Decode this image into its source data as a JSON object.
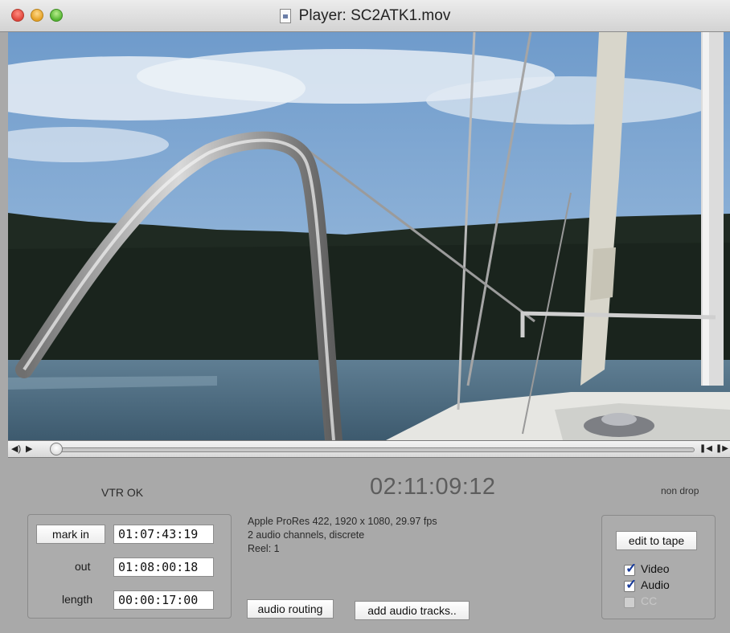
{
  "window": {
    "title": "Player: SC2ATK1.mov"
  },
  "transport": {
    "volume_icon": "speaker-icon",
    "play_icon": "play-icon",
    "step_back_icon": "step-back-icon",
    "step_forward_icon": "step-forward-icon",
    "playhead_position": 0.0
  },
  "status": {
    "vtr": "VTR OK",
    "timecode": "02:11:09:12",
    "drop_mode": "non drop"
  },
  "marks": {
    "mark_in_label": "mark in",
    "mark_in_value": "01:07:43:19",
    "out_label": "out",
    "out_value": "01:08:00:18",
    "length_label": "length",
    "length_value": "00:00:17:00"
  },
  "media_info": {
    "line1": "Apple ProRes 422, 1920 x 1080, 29.97 fps",
    "line2": "2 audio channels, discrete",
    "line3": "Reel: 1"
  },
  "buttons": {
    "audio_routing": "audio routing",
    "add_audio_tracks": "add audio tracks..",
    "edit_to_tape": "edit to tape"
  },
  "options": {
    "video": {
      "label": "Video",
      "checked": true,
      "enabled": true
    },
    "audio": {
      "label": "Audio",
      "checked": true,
      "enabled": true
    },
    "cc": {
      "label": "CC",
      "checked": false,
      "enabled": false
    }
  },
  "colors": {
    "timecode": "#5d5d5d",
    "checkmark": "#183a9a",
    "panel_background": "#a9a9a9"
  }
}
